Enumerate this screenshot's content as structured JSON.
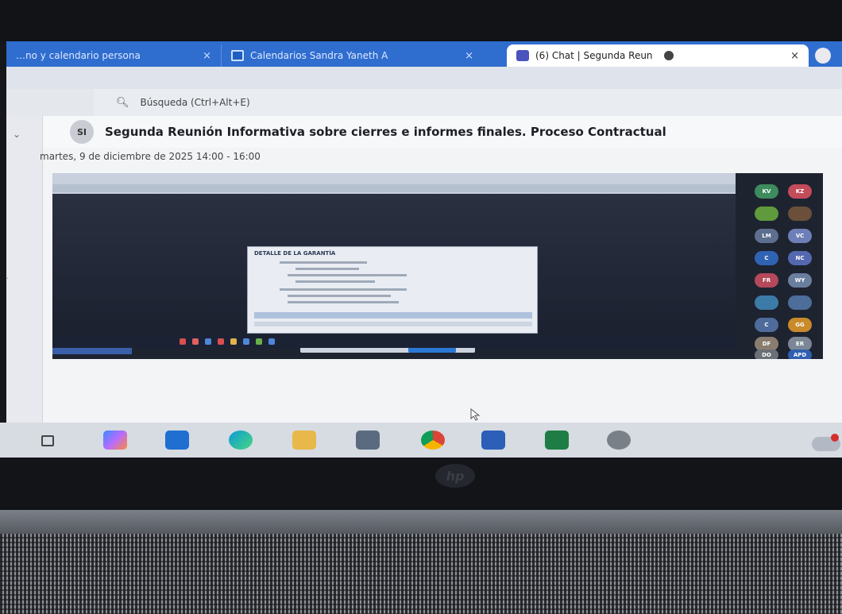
{
  "browser": {
    "tabs": [
      {
        "label": "…no y calendario persona",
        "close": "×"
      },
      {
        "label": "Calendarios Sandra Yaneth A",
        "close": "×"
      },
      {
        "label": "(6) Chat | Segunda Reun",
        "close": "×",
        "active": true
      }
    ],
    "search_placeholder": "Búsqueda (Ctrl+Alt+E)"
  },
  "meeting": {
    "avatar_initials": "SI",
    "title": "Segunda Reunión Informativa sobre cierres e informes finales. Proceso Contractual",
    "datetime": "martes, 9 de diciembre de 2025 14:00 - 16:00"
  },
  "shared_screen": {
    "dialog_title": "DETALLE DE LA GARANTÍA",
    "participants": [
      "KV",
      "KZ",
      "LM",
      "VC",
      "C",
      "NC",
      "FR",
      "WY",
      "C",
      "GG",
      "DF",
      "ER",
      "DO",
      "APD"
    ]
  },
  "icons": {
    "teams": "teams-icon",
    "calendar": "calendar-icon",
    "search": "search-icon",
    "cursor": "cursor-icon"
  },
  "colors": {
    "tab_strip": "#2f6dcf",
    "share_bg": "#1e2330",
    "taskbar": "#d7dbe2"
  }
}
